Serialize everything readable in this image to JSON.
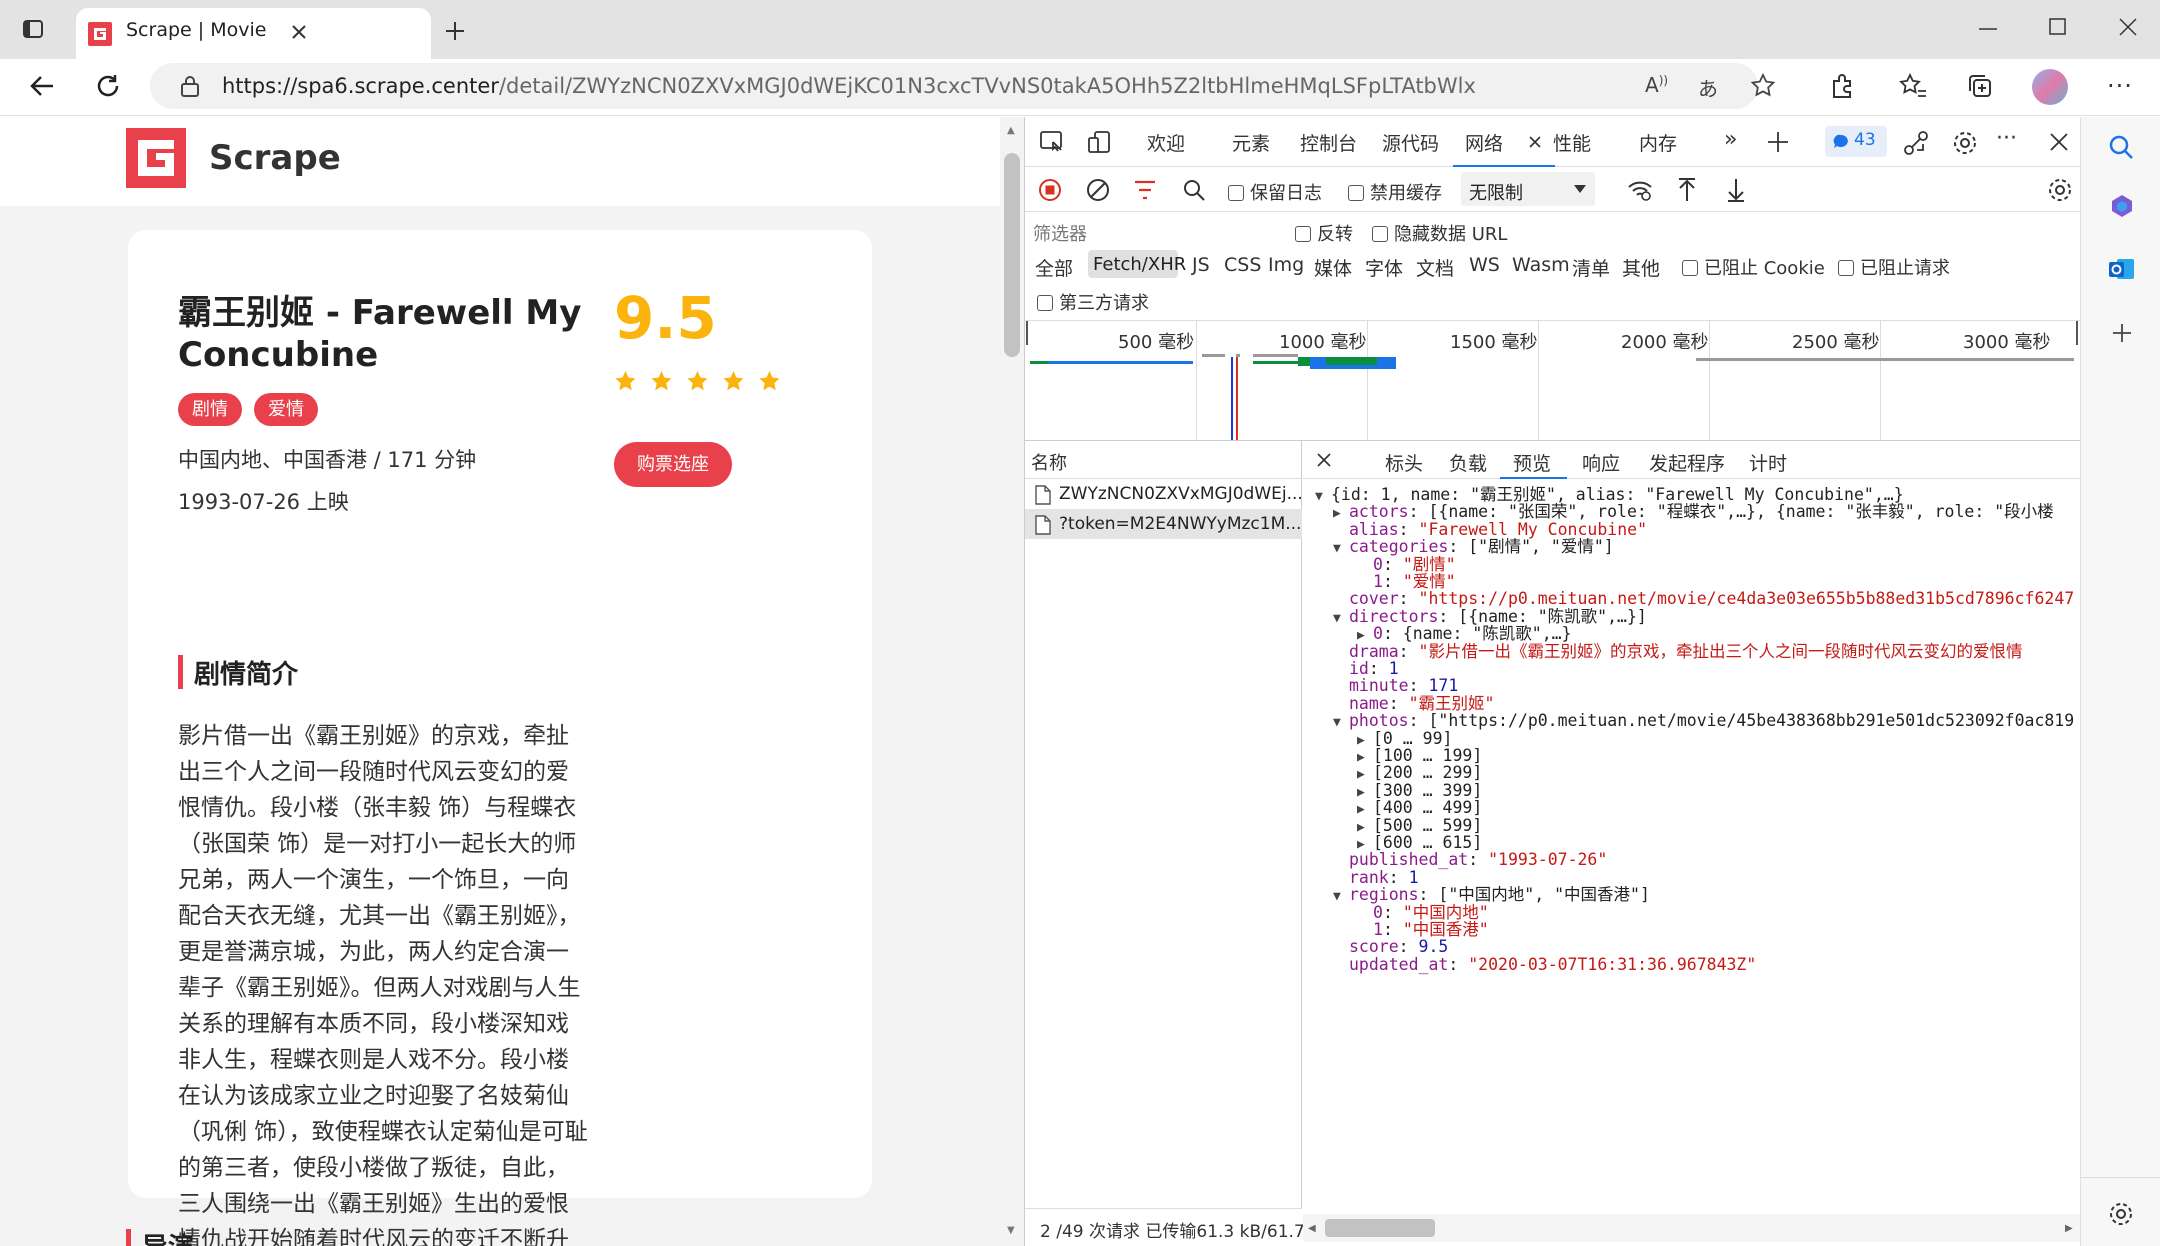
{
  "browser": {
    "tab_title": "Scrape | Movie",
    "url_host": "https://spa6.scrape.center",
    "url_path": "/detail/ZWYzNCN0ZXVxMGJ0dWEjKC01N3cxcTVvNS0takA5OHh5Z2ltbHlmeHMqLSFpLTAtbWlx"
  },
  "site": {
    "logo_text": "Scrape"
  },
  "movie": {
    "title": "霸王别姬 - Farewell My Concubine",
    "score": "9.5",
    "stars": 5,
    "categories": [
      "剧情",
      "爱情"
    ],
    "info": "中国内地、中国香港 / 171 分钟",
    "release": "1993-07-26 上映",
    "buy_label": "购票选座",
    "synopsis_heading": "剧情简介",
    "synopsis": "影片借一出《霸王别姬》的京戏，牵扯出三个人之间一段随时代风云变幻的爱恨情仇。段小楼（张丰毅 饰）与程蝶衣（张国荣 饰）是一对打小一起长大的师兄弟，两人一个演生，一个饰旦，一向配合天衣无缝，尤其一出《霸王别姬》，更是誉满京城，为此，两人约定合演一辈子《霸王别姬》。但两人对戏剧与人生关系的理解有本质不同，段小楼深知戏非人生，程蝶衣则是人戏不分。段小楼在认为该成家立业之时迎娶了名妓菊仙（巩俐 饰），致使程蝶衣认定菊仙是可耻的第三者，使段小楼做了叛徒，自此，三人围绕一出《霸王别姬》生出的爱恨情仇战开始随着时代风云的变迁不断升级，终酿成悲剧。",
    "next_heading": "导演"
  },
  "devtools": {
    "tabs": [
      "欢迎",
      "元素",
      "控制台",
      "源代码",
      "网络",
      "性能",
      "内存"
    ],
    "active_tab": "网络",
    "badge_count": "43",
    "toolbar": {
      "preserve_log": "保留日志",
      "disable_cache": "禁用缓存",
      "throttle": "无限制"
    },
    "filter": {
      "placeholder": "筛选器",
      "invert": "反转",
      "hide_data_urls": "隐藏数据 URL",
      "third_party": "第三方请求",
      "blocked_cookies": "已阻止 Cookie",
      "blocked_requests": "已阻止请求",
      "types": [
        "全部",
        "Fetch/XHR",
        "JS",
        "CSS",
        "Img",
        "媒体",
        "字体",
        "文档",
        "WS",
        "Wasm",
        "清单",
        "其他"
      ],
      "active_type": "Fetch/XHR"
    },
    "timeline_ticks": [
      "500 毫秒",
      "1000 毫秒",
      "1500 毫秒",
      "2000 毫秒",
      "2500 毫秒",
      "3000 毫秒"
    ],
    "requests_header": "名称",
    "requests": [
      "ZWYzNCN0ZXVxMGJ0dWEj...",
      "?token=M2E4NWYyMzc1M..."
    ],
    "status_bar": "2 /49 次请求  已传输61.3 kB/61.7",
    "preview_tabs": [
      "标头",
      "负载",
      "预览",
      "响应",
      "发起程序",
      "计时"
    ],
    "active_preview_tab": "预览",
    "json_lines": [
      {
        "indent": 0,
        "toggle": "▼",
        "parts": [
          [
            "g",
            "{id: 1, name: \"霸王别姬\", alias: \"Farewell My Concubine\",…}"
          ]
        ]
      },
      {
        "indent": 1,
        "toggle": "▶",
        "parts": [
          [
            "k",
            "actors"
          ],
          [
            "g",
            ": [{name: \"张国荣\", role: \"程蝶衣\",…}, {name: \"张丰毅\", role: \"段小楼"
          ]
        ]
      },
      {
        "indent": 1,
        "toggle": "",
        "parts": [
          [
            "k",
            "alias"
          ],
          [
            "g",
            ": "
          ],
          [
            "s",
            "\"Farewell My Concubine\""
          ]
        ]
      },
      {
        "indent": 1,
        "toggle": "▼",
        "parts": [
          [
            "k",
            "categories"
          ],
          [
            "g",
            ": [\"剧情\", \"爱情\"]"
          ]
        ]
      },
      {
        "indent": 2,
        "toggle": "",
        "parts": [
          [
            "k",
            "0"
          ],
          [
            "g",
            ": "
          ],
          [
            "s",
            "\"剧情\""
          ]
        ]
      },
      {
        "indent": 2,
        "toggle": "",
        "parts": [
          [
            "k",
            "1"
          ],
          [
            "g",
            ": "
          ],
          [
            "s",
            "\"爱情\""
          ]
        ]
      },
      {
        "indent": 1,
        "toggle": "",
        "parts": [
          [
            "k",
            "cover"
          ],
          [
            "g",
            ": "
          ],
          [
            "s",
            "\"https://p0.meituan.net/movie/ce4da3e03e655b5b88ed31b5cd7896cf6247"
          ]
        ]
      },
      {
        "indent": 1,
        "toggle": "▼",
        "parts": [
          [
            "k",
            "directors"
          ],
          [
            "g",
            ": [{name: \"陈凯歌\",…}]"
          ]
        ]
      },
      {
        "indent": 2,
        "toggle": "▶",
        "parts": [
          [
            "k",
            "0"
          ],
          [
            "g",
            ": {name: \"陈凯歌\",…}"
          ]
        ]
      },
      {
        "indent": 1,
        "toggle": "",
        "parts": [
          [
            "k",
            "drama"
          ],
          [
            "g",
            ": "
          ],
          [
            "s",
            "\"影片借一出《霸王别姬》的京戏，牵扯出三个人之间一段随时代风云变幻的爱恨情"
          ]
        ]
      },
      {
        "indent": 1,
        "toggle": "",
        "parts": [
          [
            "k",
            "id"
          ],
          [
            "g",
            ": "
          ],
          [
            "n",
            "1"
          ]
        ]
      },
      {
        "indent": 1,
        "toggle": "",
        "parts": [
          [
            "k",
            "minute"
          ],
          [
            "g",
            ": "
          ],
          [
            "n",
            "171"
          ]
        ]
      },
      {
        "indent": 1,
        "toggle": "",
        "parts": [
          [
            "k",
            "name"
          ],
          [
            "g",
            ": "
          ],
          [
            "s",
            "\"霸王别姬\""
          ]
        ]
      },
      {
        "indent": 1,
        "toggle": "▼",
        "parts": [
          [
            "k",
            "photos"
          ],
          [
            "g",
            ": [\"https://p0.meituan.net/movie/45be438368bb291e501dc523092f0ac819"
          ]
        ]
      },
      {
        "indent": 2,
        "toggle": "▶",
        "parts": [
          [
            "g",
            "[0 … 99]"
          ]
        ]
      },
      {
        "indent": 2,
        "toggle": "▶",
        "parts": [
          [
            "g",
            "[100 … 199]"
          ]
        ]
      },
      {
        "indent": 2,
        "toggle": "▶",
        "parts": [
          [
            "g",
            "[200 … 299]"
          ]
        ]
      },
      {
        "indent": 2,
        "toggle": "▶",
        "parts": [
          [
            "g",
            "[300 … 399]"
          ]
        ]
      },
      {
        "indent": 2,
        "toggle": "▶",
        "parts": [
          [
            "g",
            "[400 … 499]"
          ]
        ]
      },
      {
        "indent": 2,
        "toggle": "▶",
        "parts": [
          [
            "g",
            "[500 … 599]"
          ]
        ]
      },
      {
        "indent": 2,
        "toggle": "▶",
        "parts": [
          [
            "g",
            "[600 … 615]"
          ]
        ]
      },
      {
        "indent": 1,
        "toggle": "",
        "parts": [
          [
            "k",
            "published_at"
          ],
          [
            "g",
            ": "
          ],
          [
            "s",
            "\"1993-07-26\""
          ]
        ]
      },
      {
        "indent": 1,
        "toggle": "",
        "parts": [
          [
            "k",
            "rank"
          ],
          [
            "g",
            ": "
          ],
          [
            "n",
            "1"
          ]
        ]
      },
      {
        "indent": 1,
        "toggle": "▼",
        "parts": [
          [
            "k",
            "regions"
          ],
          [
            "g",
            ": [\"中国内地\", \"中国香港\"]"
          ]
        ]
      },
      {
        "indent": 2,
        "toggle": "",
        "parts": [
          [
            "k",
            "0"
          ],
          [
            "g",
            ": "
          ],
          [
            "s",
            "\"中国内地\""
          ]
        ]
      },
      {
        "indent": 2,
        "toggle": "",
        "parts": [
          [
            "k",
            "1"
          ],
          [
            "g",
            ": "
          ],
          [
            "s",
            "\"中国香港\""
          ]
        ]
      },
      {
        "indent": 1,
        "toggle": "",
        "parts": [
          [
            "k",
            "score"
          ],
          [
            "g",
            ": "
          ],
          [
            "n",
            "9.5"
          ]
        ]
      },
      {
        "indent": 1,
        "toggle": "",
        "parts": [
          [
            "k",
            "updated_at"
          ],
          [
            "g",
            ": "
          ],
          [
            "s",
            "\"2020-03-07T16:31:36.967843Z\""
          ]
        ]
      }
    ]
  },
  "colors": {
    "accent": "#e8414b",
    "score": "#fbb40c",
    "devtools_active": "#1a73e8"
  }
}
